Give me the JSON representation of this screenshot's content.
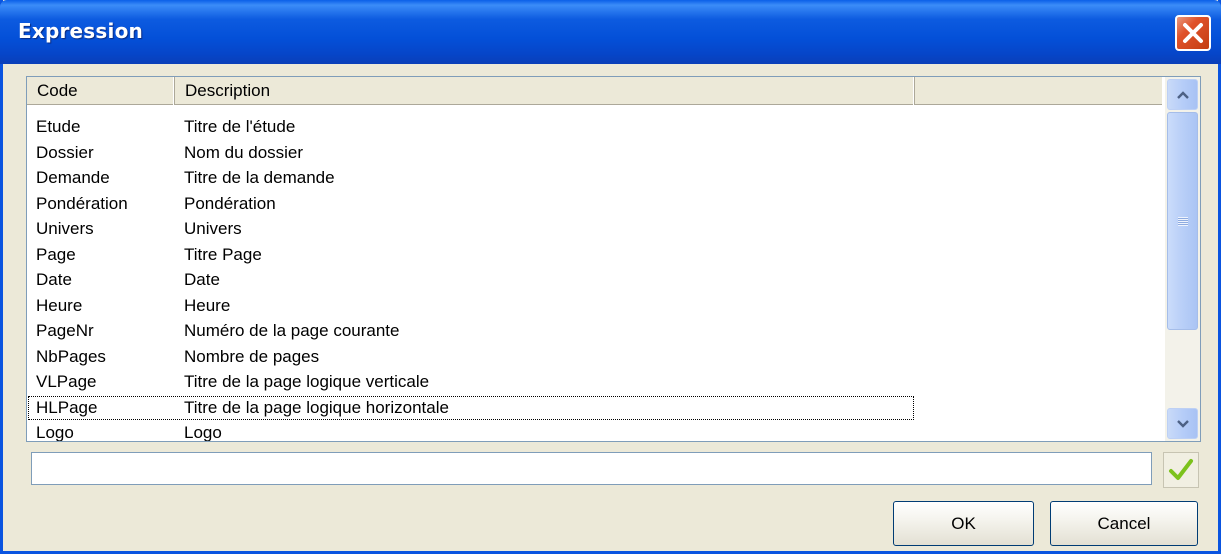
{
  "window": {
    "title": "Expression"
  },
  "list": {
    "columns": [
      "Code",
      "Description",
      ""
    ],
    "rows": [
      {
        "code": "Etude",
        "description": "Titre de l'étude"
      },
      {
        "code": "Dossier",
        "description": "Nom du dossier"
      },
      {
        "code": "Demande",
        "description": "Titre de la demande"
      },
      {
        "code": "Pondération",
        "description": "Pondération"
      },
      {
        "code": "Univers",
        "description": "Univers"
      },
      {
        "code": "Page",
        "description": "Titre Page"
      },
      {
        "code": "Date",
        "description": "Date"
      },
      {
        "code": "Heure",
        "description": "Heure"
      },
      {
        "code": "PageNr",
        "description": "Numéro de la page courante"
      },
      {
        "code": "NbPages",
        "description": "Nombre de pages"
      },
      {
        "code": "VLPage",
        "description": "Titre de la page logique verticale"
      },
      {
        "code": "HLPage",
        "description": "Titre de la page logique horizontale"
      },
      {
        "code": "Logo",
        "description": "Logo"
      }
    ],
    "focused_row": "HLPage"
  },
  "expression_input": {
    "value": ""
  },
  "buttons": {
    "ok": "OK",
    "cancel": "Cancel"
  },
  "icons": {
    "close": "close-icon",
    "apply": "checkmark-icon",
    "scroll_up": "chevron-up-icon",
    "scroll_down": "chevron-down-icon"
  },
  "colors": {
    "titlebar": "#0a54e0",
    "close_button": "#e0522a",
    "checkmark": "#7cc21c",
    "face": "#ece9d8"
  }
}
